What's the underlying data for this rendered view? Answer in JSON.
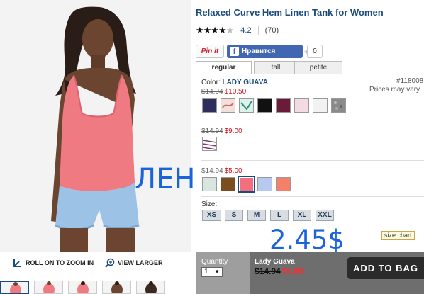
{
  "product": {
    "title": "Relaxed Curve Hem Linen Tank for Women",
    "stars_filled": "★★★★",
    "stars_empty": "★",
    "rating": "4.2",
    "review_count": "(70)"
  },
  "social": {
    "pin_label": "Pin it",
    "fb_label": "Нравится",
    "fb_count": "0"
  },
  "fit_tabs": [
    {
      "label": "regular",
      "active": true
    },
    {
      "label": "tall",
      "active": false
    },
    {
      "label": "petite",
      "active": false
    }
  ],
  "color": {
    "label": "Color:",
    "name": "LADY GUAVA"
  },
  "item_number": "#118008",
  "prices_vary": "Prices may vary",
  "price_groups": [
    {
      "regular": "$14.94",
      "sale": "$10.50",
      "swatches": [
        "#2e2e5c",
        "#f2e0dc",
        "#e0f0ea",
        "#111111",
        "#6b1a3a",
        "#f4dbe3",
        "#f2f2f2",
        "#8a8a8a"
      ]
    },
    {
      "regular": "$14.94",
      "sale": "$9.00",
      "swatches": [
        "#ffffff"
      ]
    },
    {
      "regular": "$14.94",
      "sale": "$5.00",
      "swatches": [
        "#d8e6df",
        "#7a4e1e",
        "#f36e7e",
        "#b6c9ef",
        "#f5806a"
      ],
      "selected_swatch": 2
    }
  ],
  "size": {
    "label": "Size:",
    "options": [
      "XS",
      "S",
      "M",
      "L",
      "XL",
      "XXL"
    ],
    "size_chart": "size chart"
  },
  "overlays": {
    "word": "ЛЕН",
    "price": "2.45$"
  },
  "photo_links": {
    "zoom": "ROLL ON TO ZOOM IN",
    "larger": "VIEW LARGER"
  },
  "buybar": {
    "qty_label": "Quantity",
    "qty_value": "1",
    "color_name": "Lady Guava",
    "regular": "$14.94",
    "sale": "$5.00",
    "add_button": "ADD TO BAG"
  },
  "colors": {
    "title_blue": "#1b4c7c",
    "sale_red": "#d0121b",
    "overlay_blue": "#1a63d8",
    "tank_coral": "#f07a82"
  }
}
